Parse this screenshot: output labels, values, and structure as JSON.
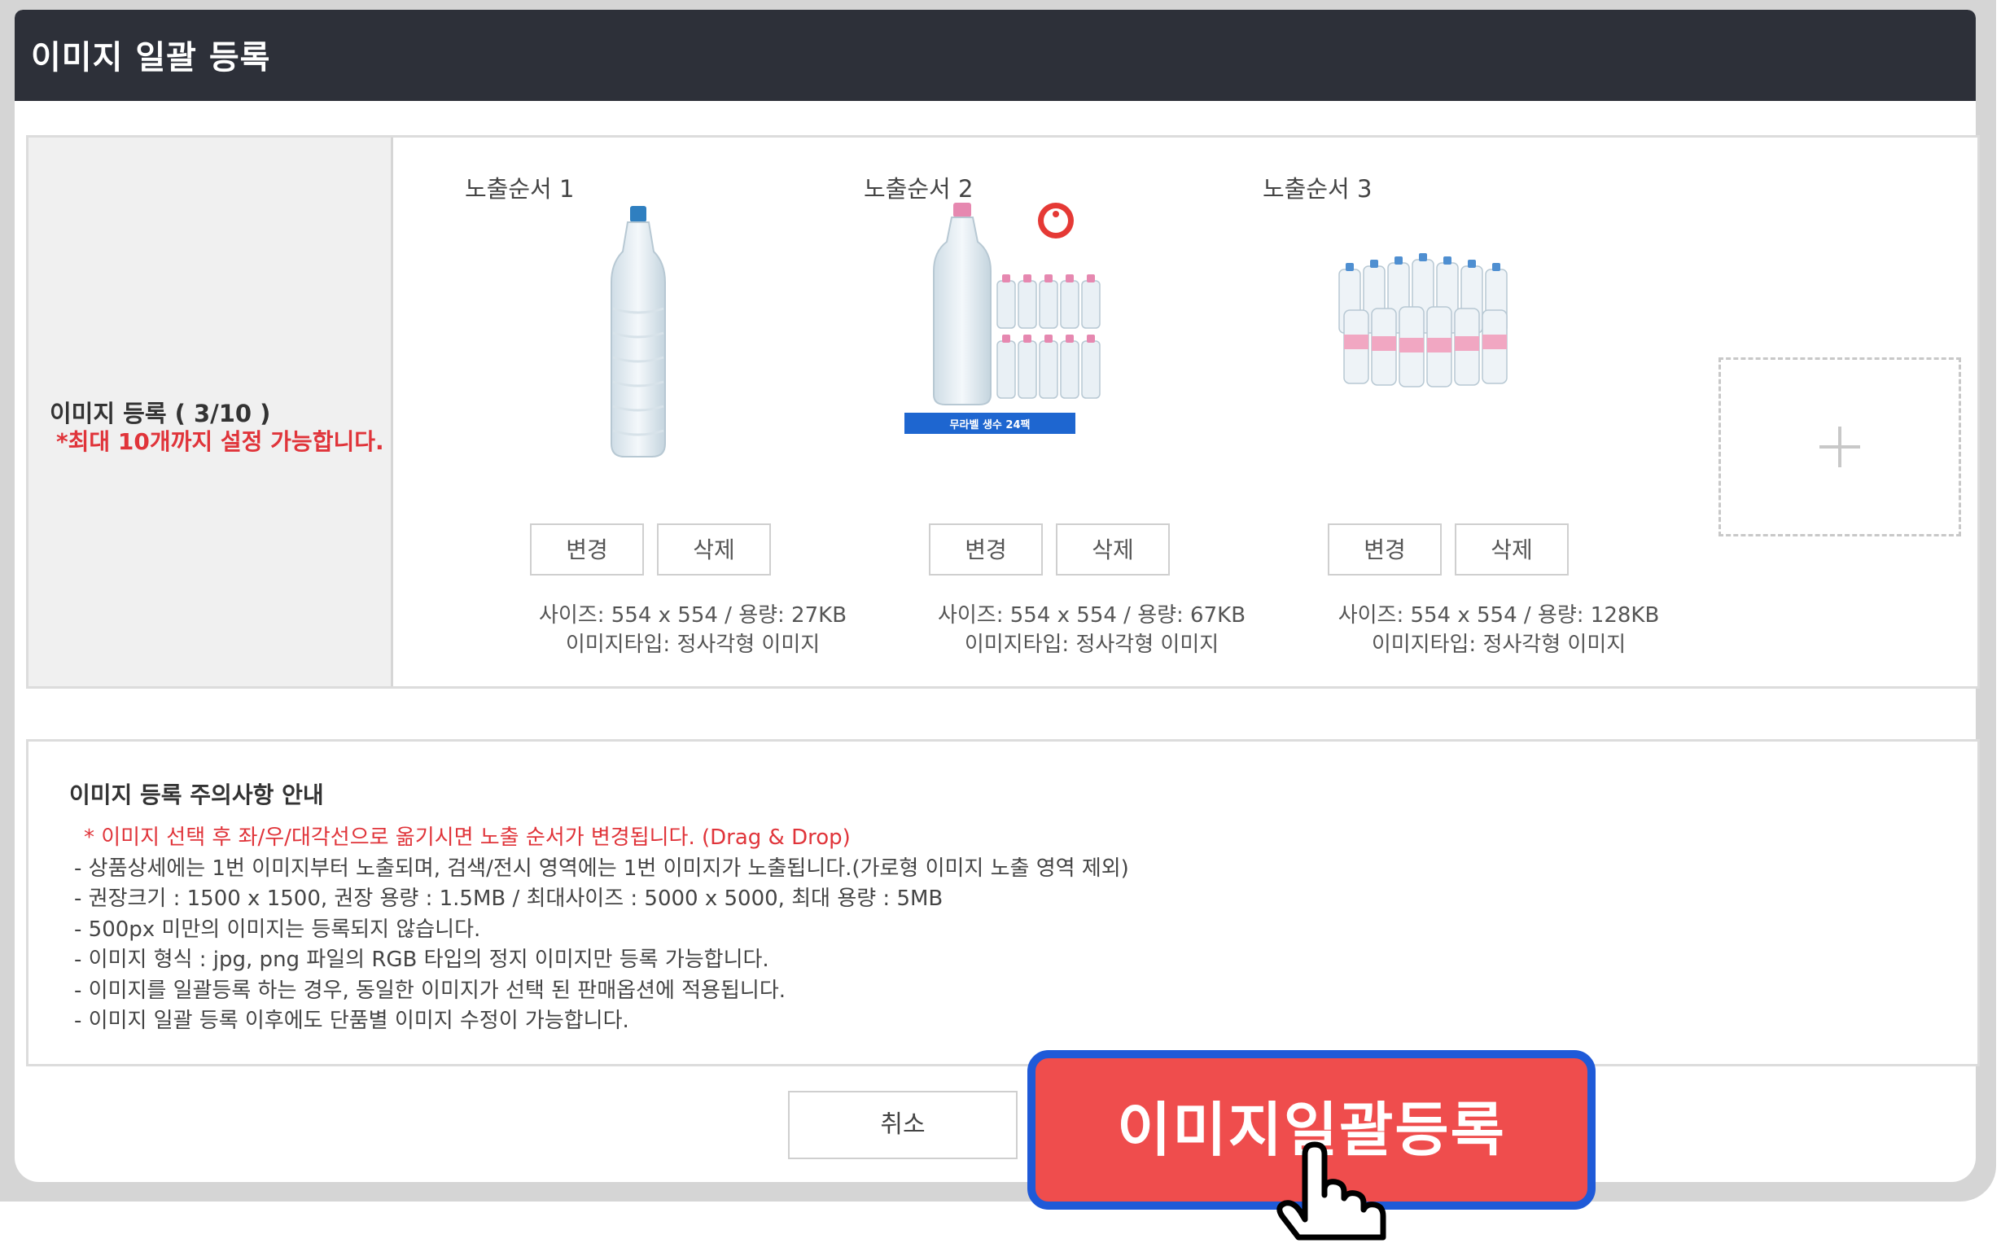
{
  "modal": {
    "title": "이미지 일괄 등록"
  },
  "register": {
    "label": "이미지 등록 ( 3/10 )",
    "note": "*최대 10개까지 설정 가능합니다.",
    "slots": [
      {
        "title": "노출순서 1",
        "change_label": "변경",
        "delete_label": "삭제",
        "size_text": "사이즈: 554 x 554 / 용량: 27KB",
        "type_text": "이미지타입: 정사각형 이미지"
      },
      {
        "title": "노출순서 2",
        "change_label": "변경",
        "delete_label": "삭제",
        "size_text": "사이즈: 554 x 554 / 용량: 67KB",
        "type_text": "이미지타입: 정사각형 이미지",
        "banner_text": "무라벨 생수 24팩"
      },
      {
        "title": "노출순서 3",
        "change_label": "변경",
        "delete_label": "삭제",
        "size_text": "사이즈: 554 x 554 / 용량: 128KB",
        "type_text": "이미지타입: 정사각형 이미지"
      }
    ],
    "add_icon": "plus-icon"
  },
  "notice": {
    "title": "이미지 등록 주의사항 안내",
    "highlight": "* 이미지 선택 후 좌/우/대각선으로 옮기시면 노출 순서가 변경됩니다. (Drag & Drop)",
    "lines": [
      "- 상품상세에는 1번 이미지부터 노출되며, 검색/전시 영역에는 1번 이미지가 노출됩니다.(가로형 이미지 노출 영역 제외)",
      "- 권장크기 : 1500 x 1500, 권장 용량 : 1.5MB / 최대사이즈 : 5000 x 5000, 최대 용량 : 5MB",
      "- 500px 미만의 이미지는 등록되지 않습니다.",
      "- 이미지 형식 : jpg, png 파일의 RGB 타입의 정지 이미지만 등록 가능합니다.",
      "- 이미지를 일괄등록 하는 경우, 동일한 이미지가 선택 된 판매옵션에 적용됩니다.",
      "- 이미지 일괄 등록 이후에도 단품별 이미지 수정이 가능합니다."
    ]
  },
  "footer": {
    "cancel_label": "취소",
    "submit_label": "이미지일괄등록"
  },
  "colors": {
    "header_bg": "#2d3039",
    "accent_red": "#ef4d4d",
    "highlight_border": "#1f5ad8",
    "note_red": "#e0343a"
  }
}
